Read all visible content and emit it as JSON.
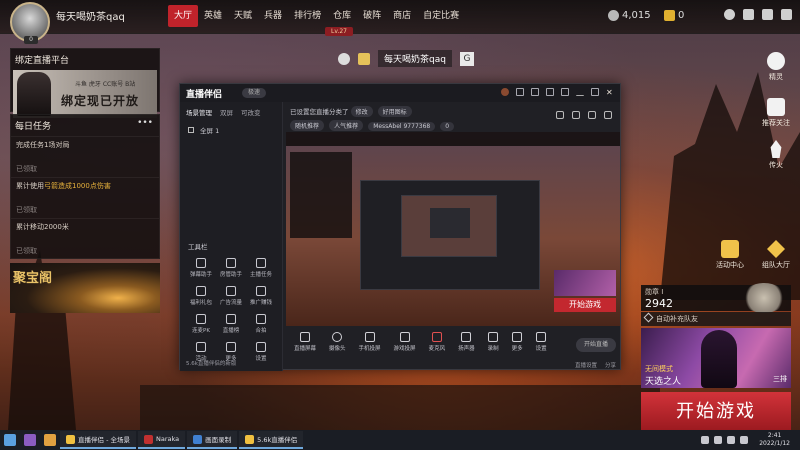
{
  "player": {
    "name": "每天喝奶茶qaq",
    "avatar_level": "0",
    "level_badge": "Lv.27"
  },
  "nav": {
    "items": [
      "大厅",
      "英雄",
      "天赋",
      "兵器",
      "排行榜",
      "仓库",
      "破阵",
      "商店",
      "自定比赛"
    ],
    "active": "大厅"
  },
  "currency": {
    "gold": "4,015",
    "coin": "0"
  },
  "center": {
    "name": "每天喝奶茶qaq",
    "badge": "G"
  },
  "left_panel": {
    "live_title": "绑定直播平台",
    "banner_small": "斗鱼 虎牙 CC账号 B站",
    "banner_big": "绑定现已开放",
    "daily_title": "每日任务",
    "dots": "•••",
    "tasks": [
      {
        "desc_pre": "完成任务1场对局",
        "highlight": "",
        "desc_post": "",
        "status": "已领取"
      },
      {
        "desc_pre": "累计使用",
        "highlight": "弓箭造成1000点伤害",
        "desc_post": "",
        "status": "已领取"
      },
      {
        "desc_pre": "累计移动2000米",
        "highlight": "",
        "desc_post": "",
        "status": "已领取"
      }
    ],
    "treasure": "聚宝阁"
  },
  "right_side": {
    "icons": [
      "精灵",
      "推荐关注",
      "传火"
    ],
    "activity": "活动中心",
    "team": "组队大厅",
    "points_label": "勋章 I",
    "points_value": "2942",
    "auto_fill": "自动补充队友",
    "mode_tag": "无间模式",
    "mode_name": "天选之人",
    "mode_count": "三排",
    "start": "开始游戏"
  },
  "stream_window": {
    "logo": "直播伴侣",
    "tag": "极速",
    "side_tabs": [
      "场景管理",
      "双屏",
      "可改变"
    ],
    "scene": "全屏 1",
    "tools_label": "工具栏",
    "tools": [
      "弹幕助手",
      "房管助手",
      "主播任务",
      "福利礼包",
      "广告流量",
      "推广赚钱",
      "连麦PK",
      "直播榜",
      "合拍",
      "活动",
      "更多",
      "设置"
    ],
    "side_bottom": "5.6k直播伴侣的新版",
    "head_line": "已设置您直播分类了",
    "head_tags": [
      "修改",
      "好用图标"
    ],
    "head_pills": [
      "随机推荐",
      "人气推荐",
      "MessAbel 9777368",
      "0"
    ],
    "bottom_items": [
      "直播屏幕",
      "摄像头",
      "手机投屏",
      "游戏投屏",
      "麦克风",
      "扬声器",
      "录制",
      "更多",
      "设置"
    ],
    "go_live": "开始直播",
    "bottom_links": [
      "直播设置",
      "分享"
    ]
  },
  "taskbar": {
    "apps": [
      "直播伴侣 - 全场景",
      "Naraka",
      "画面录制",
      "5.6k直播伴侣"
    ],
    "time": "2:41",
    "date": "2022/1/12"
  }
}
